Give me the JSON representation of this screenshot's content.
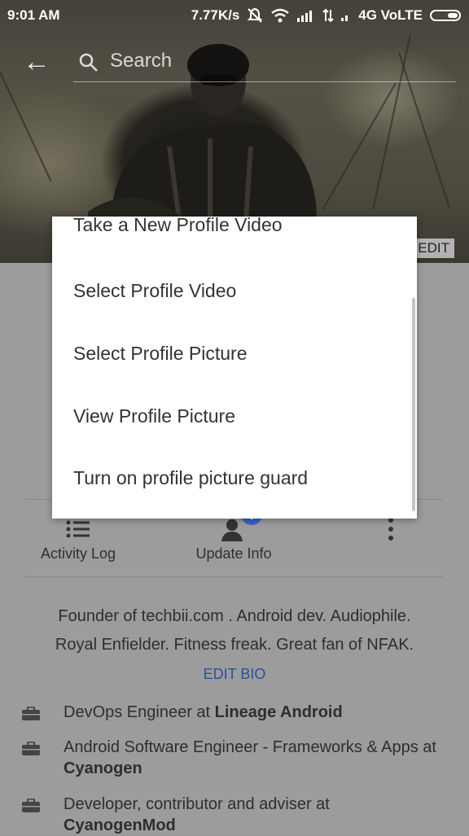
{
  "status_bar": {
    "time": "9:01 AM",
    "speed": "7.77K/s",
    "network": "4G VoLTE",
    "icons": [
      "mute-bell-icon",
      "wifi-icon",
      "signal-icon",
      "data-arrows-icon",
      "signal-small-icon",
      "battery-icon"
    ]
  },
  "search": {
    "placeholder": "Search"
  },
  "cover": {
    "edit_label": "EDIT"
  },
  "menu": {
    "items": [
      "Take a New Profile Video",
      "Select Profile Video",
      "Select Profile Picture",
      "View Profile Picture",
      "Turn on profile picture guard"
    ]
  },
  "actions": {
    "activity_log": "Activity Log",
    "update_info": "Update Info",
    "more": "more-options-icon"
  },
  "bio": {
    "line1": "Founder of techbii.com . Android dev. Audiophile.",
    "line2": "Royal Enfielder. Fitness freak. Great fan of NFAK.",
    "edit_label": "EDIT BIO"
  },
  "work": [
    {
      "prefix": "DevOps Engineer at ",
      "org": "Lineage Android"
    },
    {
      "prefix": "Android Software Engineer - Frameworks & Apps at ",
      "org": "Cyanogen"
    },
    {
      "prefix": "Developer, contributor and adviser at ",
      "org": "CyanogenMod"
    }
  ],
  "colors": {
    "accent_blue": "#3b62c4",
    "overlay_gray": "#9c9c9c"
  }
}
